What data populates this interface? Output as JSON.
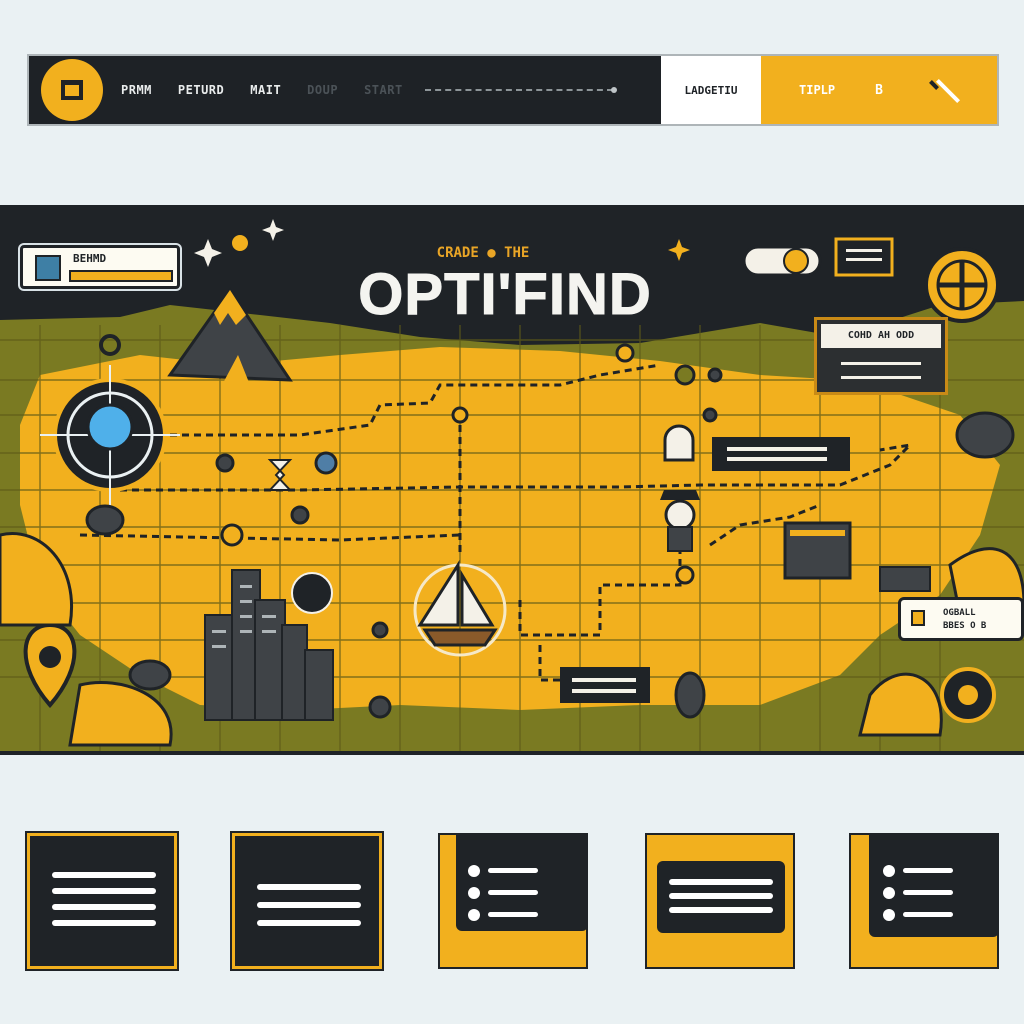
{
  "nav": {
    "items": [
      "PRMM",
      "PETURD",
      "MAIT",
      "DOUP",
      "START"
    ],
    "white_button": "LADGETIU",
    "yellow_label": "TIPLP",
    "yellow_button": "B",
    "tool_icon": "wrench-icon",
    "logo_icon": "app-logo-icon"
  },
  "hero": {
    "pre_title": "CRADE ● THE",
    "title": "OPTI'FIND",
    "player_name": "BEHMD",
    "quest_title": "COHD AH ODD",
    "reward_text_1": "OGBALL",
    "reward_text_2": "BBES O B",
    "toggle_value": "0"
  },
  "colors": {
    "accent": "#f2b01e",
    "dark": "#1f2327",
    "grass": "#7a7a22",
    "water": "#4fb0ea",
    "background": "#eaf1f3"
  },
  "cards": [
    {
      "style": "dark-bordered",
      "kind": "lines"
    },
    {
      "style": "dark-bordered",
      "kind": "lines"
    },
    {
      "style": "yellow-corner",
      "kind": "list"
    },
    {
      "style": "yellow-dark",
      "kind": "lines"
    },
    {
      "style": "yellow-corner",
      "kind": "list"
    }
  ]
}
